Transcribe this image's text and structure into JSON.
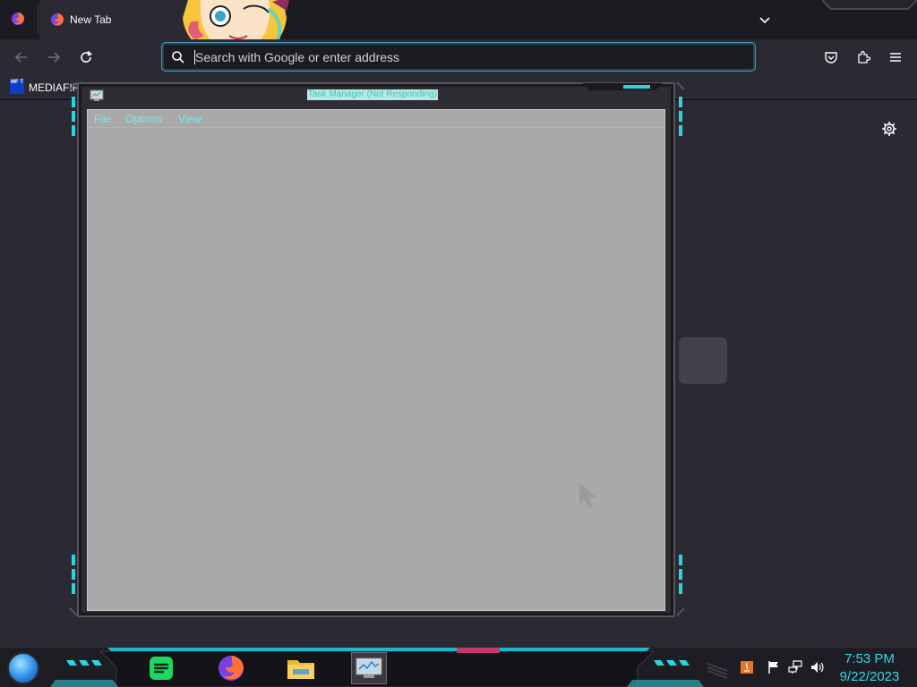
{
  "browser": {
    "tab": {
      "label": "New Tab"
    },
    "urlbar": {
      "placeholder": "Search with Google or enter address"
    },
    "bookmarks": [
      {
        "label": "MEDIAFIRE",
        "icon_text": "MF T"
      }
    ]
  },
  "task_manager": {
    "title": "Task Manager (Not Responding)",
    "menus": [
      "File",
      "Options",
      "View"
    ]
  },
  "taskbar": {
    "apps": [
      {
        "name": "spotify",
        "active": false
      },
      {
        "name": "firefox",
        "active": false
      },
      {
        "name": "file-explorer",
        "active": false
      },
      {
        "name": "task-manager",
        "active": true
      }
    ],
    "clock": {
      "time": "7:53 PM",
      "date": "9/22/2023"
    }
  },
  "colors": {
    "accent_cyan": "#37d6e6",
    "browser_bg": "#2b2a33",
    "tabstrip_bg": "#1c1b22",
    "window_client": "#a9a9a9"
  }
}
